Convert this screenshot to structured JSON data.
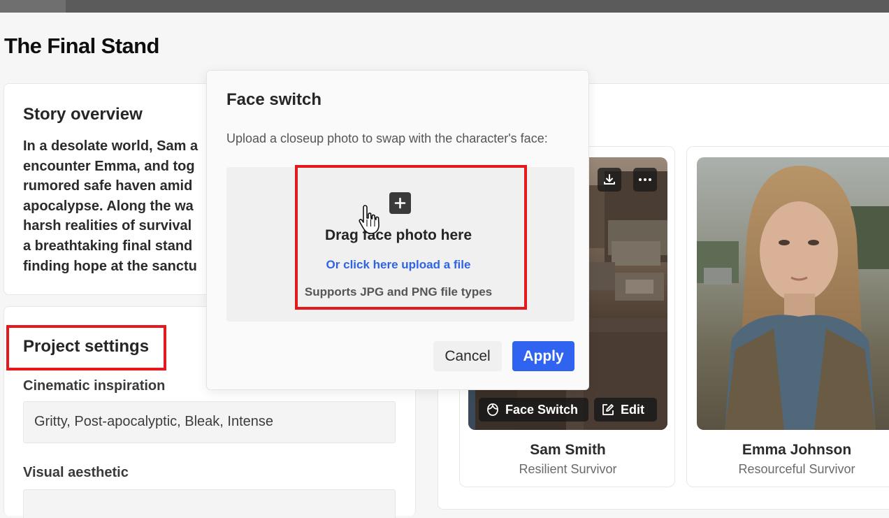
{
  "page": {
    "title": "The Final Stand"
  },
  "story": {
    "heading": "Story overview",
    "lines": [
      "In a desolate world, Sam a",
      "encounter Emma, and tog",
      "rumored safe haven amid",
      "apocalypse. Along the wa",
      "harsh realities of survival",
      "a breathtaking final stand",
      "finding hope at the sanctu"
    ]
  },
  "settings": {
    "heading": "Project settings",
    "cinematic_label": "Cinematic inspiration",
    "cinematic_value": "Gritty, Post-apocalyptic, Bleak, Intense",
    "visual_label": "Visual aesthetic"
  },
  "characters": [
    {
      "name": "Sam Smith",
      "role": "Resilient Survivor",
      "face_switch_label": "Face Switch",
      "edit_label": "Edit"
    },
    {
      "name": "Emma Johnson",
      "role": "Resourceful Survivor"
    }
  ],
  "modal": {
    "title": "Face switch",
    "subtitle": "Upload a closeup photo to swap with the character's face:",
    "drop_title": "Drag face photo here",
    "drop_link": "Or click here upload a file",
    "drop_note": "Supports JPG and PNG file types",
    "cancel_label": "Cancel",
    "apply_label": "Apply"
  },
  "colors": {
    "accent": "#2f63f0",
    "link": "#2f63e4",
    "highlight": "#e3191e"
  },
  "icons": [
    "download-icon",
    "more-icon",
    "face-icon",
    "edit-icon",
    "plus-icon",
    "hand-cursor-icon"
  ]
}
